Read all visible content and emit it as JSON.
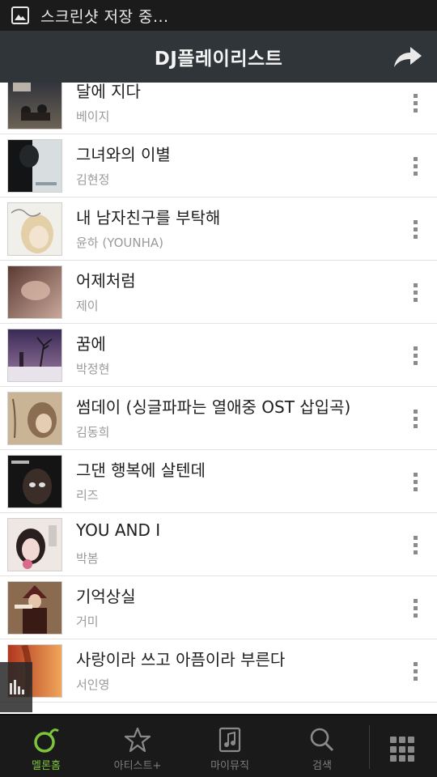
{
  "status_bar": {
    "icon": "image-icon",
    "text": "스크린샷 저장 중..."
  },
  "header": {
    "title": "DJ플레이리스트",
    "share_icon": "share-arrow-icon"
  },
  "songs": [
    {
      "title": "달에 지다",
      "artist": "베이지"
    },
    {
      "title": "그녀와의 이별",
      "artist": "김현정"
    },
    {
      "title": "내 남자친구를 부탁해",
      "artist": "윤하 (YOUNHA)"
    },
    {
      "title": "어제처럼",
      "artist": "제이"
    },
    {
      "title": "꿈에",
      "artist": "박정현"
    },
    {
      "title": "썸데이 (싱글파파는 열애중 OST 삽입곡)",
      "artist": "김동희"
    },
    {
      "title": "그댄 행복에 살텐데",
      "artist": "리즈"
    },
    {
      "title": "YOU AND I",
      "artist": "박봄"
    },
    {
      "title": "기억상실",
      "artist": "거미"
    },
    {
      "title": "사랑이라 쓰고 아픔이라 부른다",
      "artist": "서인영"
    }
  ],
  "bottom_nav": [
    {
      "label": "멜론홈",
      "icon": "melon-home-icon",
      "active": true
    },
    {
      "label": "아티스트+",
      "icon": "star-icon",
      "active": false
    },
    {
      "label": "마이뮤직",
      "icon": "music-note-icon",
      "active": false
    },
    {
      "label": "검색",
      "icon": "search-icon",
      "active": false
    }
  ],
  "menu_icon": "grid-menu-icon",
  "colors": {
    "header_bg": "#2f3538",
    "status_bg": "#1b1b1b",
    "nav_bg": "#1a1a1a",
    "accent": "#7cc43a"
  }
}
